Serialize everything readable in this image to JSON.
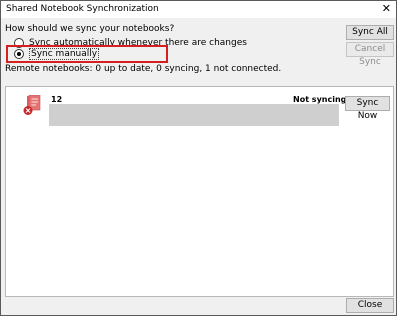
{
  "window": {
    "title": "Shared Notebook Synchronization",
    "close_glyph": "✕"
  },
  "sync_options": {
    "question": "How should we sync your notebooks?",
    "auto_label": "Sync automatically whenever there are changes",
    "manual_label": "Sync manually",
    "selected": "manual"
  },
  "buttons": {
    "sync_all": "Sync All",
    "cancel_sync": "Cancel Sync",
    "sync_now": "Sync Now",
    "close": "Close"
  },
  "status_text": "Remote notebooks: 0 up to date, 0 syncing, 1 not connected.",
  "notebooks": [
    {
      "name": "12",
      "status": "Not syncing.",
      "icon": "notebook-error-icon"
    }
  ],
  "colors": {
    "highlight": "#d42020",
    "notebook_icon": "#e57373",
    "error_badge": "#c62828"
  }
}
